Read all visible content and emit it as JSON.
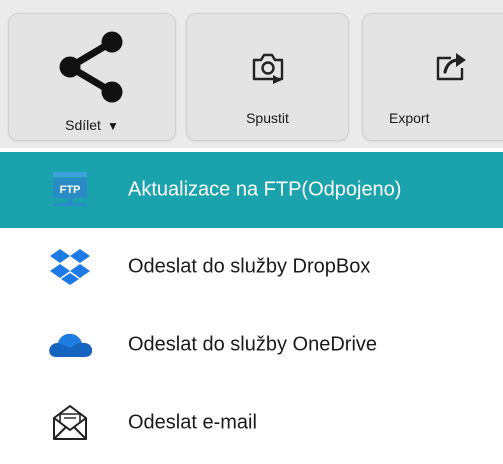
{
  "toolbar": {
    "share_label": "Sdílet",
    "share_caret": "▼",
    "run_label": "Spustit",
    "export_label": "Export"
  },
  "menu": {
    "items": [
      {
        "label": "Aktualizace na FTP(Odpojeno)",
        "icon": "ftp-server-icon",
        "active": true
      },
      {
        "label": "Odeslat do služby DropBox",
        "icon": "dropbox-icon",
        "active": false
      },
      {
        "label": "Odeslat do služby OneDrive",
        "icon": "onedrive-icon",
        "active": false
      },
      {
        "label": "Odeslat e-mail",
        "icon": "email-icon",
        "active": false
      }
    ]
  },
  "colors": {
    "active_row": "#1aa3ad",
    "dropbox": "#1e7be6",
    "onedrive": "#1565c0",
    "ftp": "#2a8cc7"
  },
  "ftp_icon_text": "FTP"
}
